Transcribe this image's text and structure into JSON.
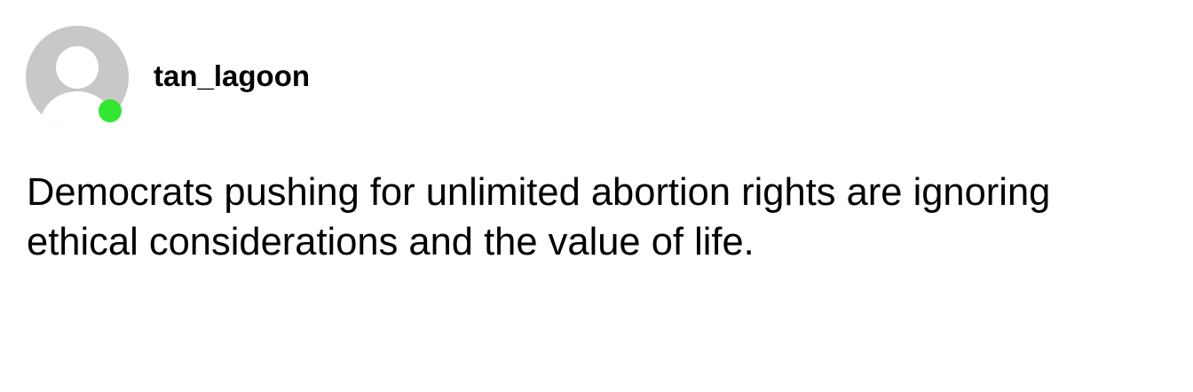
{
  "post": {
    "username": "tan_lagoon",
    "text": "Democrats pushing for unlimited abortion rights are ignoring ethical considerations and the value of life.",
    "avatar_icon": "default-user-avatar-icon",
    "status": "online"
  },
  "colors": {
    "avatar": "#c8c8c8",
    "status_online": "#33e633",
    "text": "#000000",
    "background": "#ffffff"
  }
}
